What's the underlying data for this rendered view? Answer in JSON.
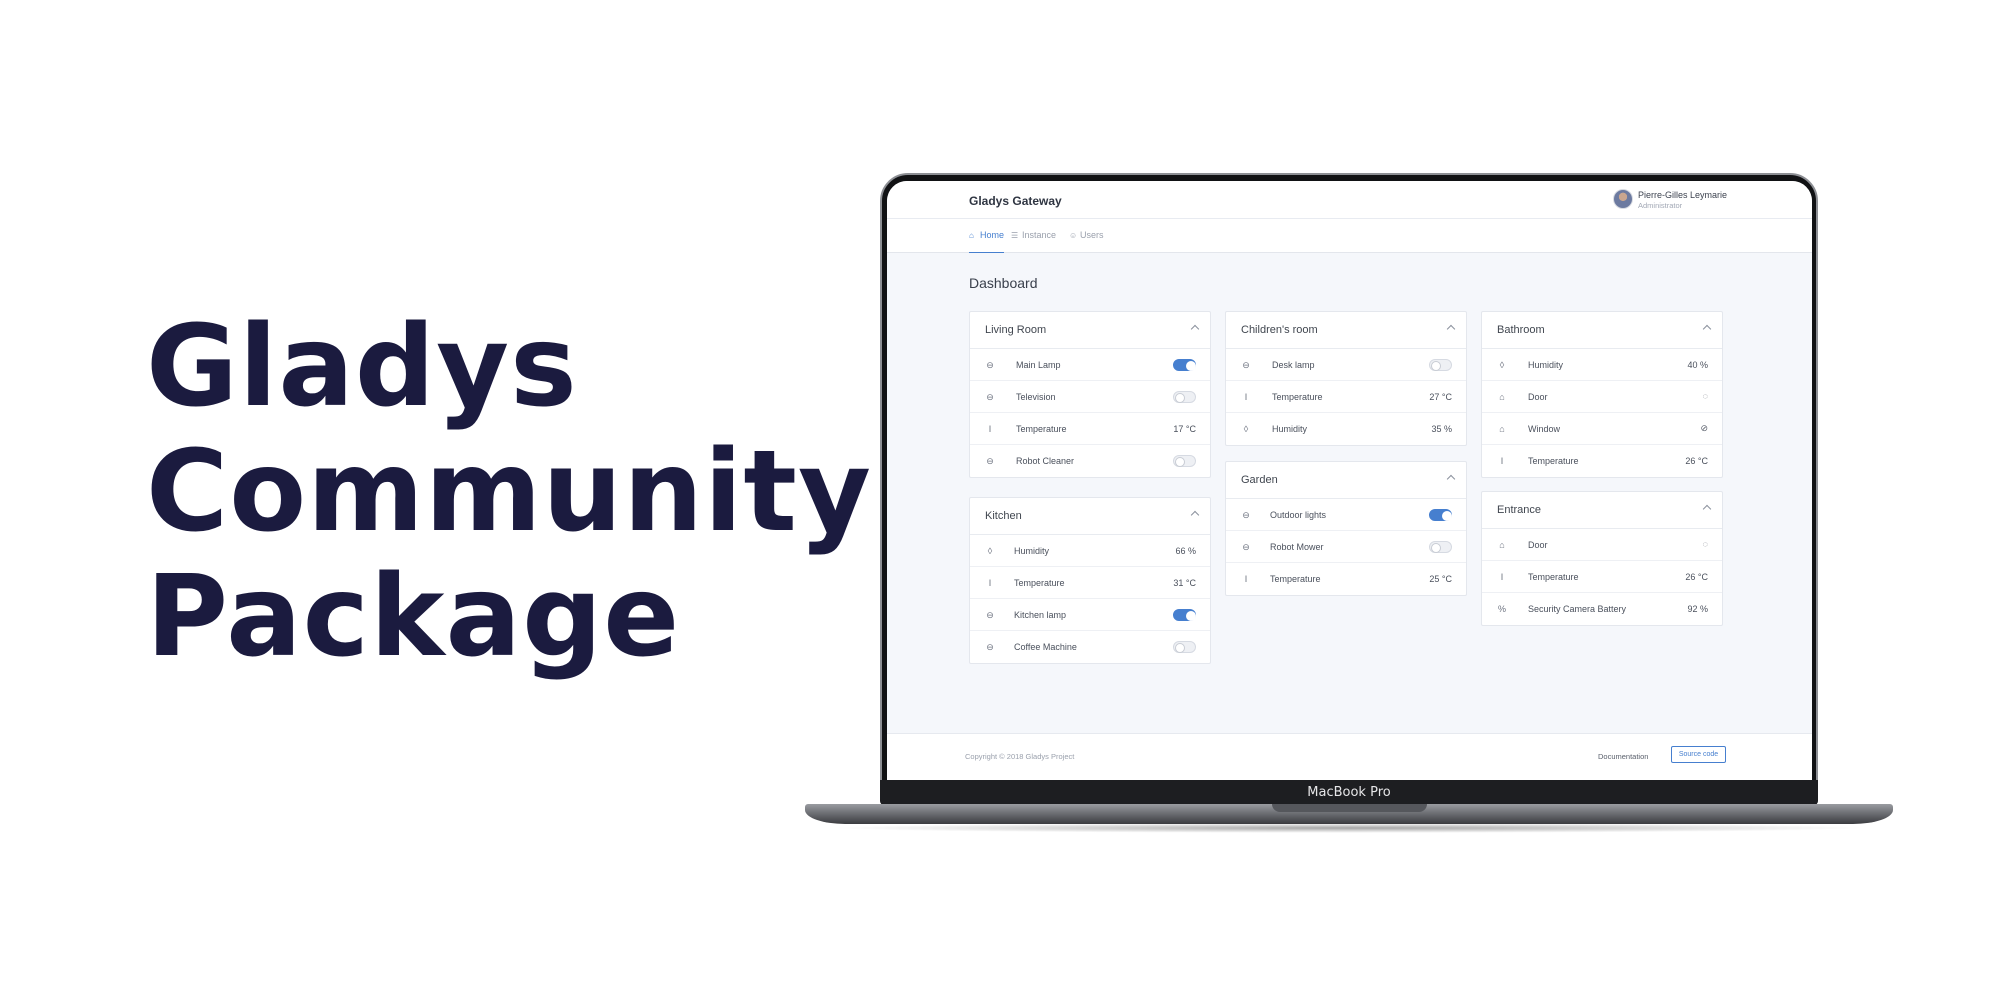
{
  "headline": {
    "line1": "Gladys",
    "line2": "Community",
    "line3": "Package"
  },
  "laptop": {
    "label": "MacBook Pro"
  },
  "app": {
    "brand": "Gladys Gateway",
    "user": {
      "name": "Pierre-Gilles Leymarie",
      "role": "Administrator"
    },
    "nav": [
      {
        "label": "Home",
        "icon": "home-icon",
        "active": true
      },
      {
        "label": "Instance",
        "icon": "server-icon",
        "active": false
      },
      {
        "label": "Users",
        "icon": "user-icon",
        "active": false
      }
    ],
    "page_title": "Dashboard",
    "accent_color": "#467fcf",
    "rooms": {
      "living_room": {
        "title": "Living Room",
        "rows": [
          {
            "icon": "toggle-icon",
            "label": "Main Lamp",
            "toggle": true
          },
          {
            "icon": "toggle-icon",
            "label": "Television",
            "toggle": false
          },
          {
            "icon": "thermometer-icon",
            "label": "Temperature",
            "value": "17 °C"
          },
          {
            "icon": "toggle-icon",
            "label": "Robot Cleaner",
            "toggle": false
          }
        ]
      },
      "kitchen": {
        "title": "Kitchen",
        "rows": [
          {
            "icon": "droplet-icon",
            "label": "Humidity",
            "value": "66 %"
          },
          {
            "icon": "thermometer-icon",
            "label": "Temperature",
            "value": "31 °C"
          },
          {
            "icon": "toggle-icon",
            "label": "Kitchen lamp",
            "toggle": true
          },
          {
            "icon": "toggle-icon",
            "label": "Coffee Machine",
            "toggle": false
          }
        ]
      },
      "childrens_room": {
        "title": "Children's room",
        "rows": [
          {
            "icon": "toggle-icon",
            "label": "Desk lamp",
            "toggle": false
          },
          {
            "icon": "thermometer-icon",
            "label": "Temperature",
            "value": "27 °C"
          },
          {
            "icon": "droplet-icon",
            "label": "Humidity",
            "value": "35 %"
          }
        ]
      },
      "garden": {
        "title": "Garden",
        "rows": [
          {
            "icon": "toggle-icon",
            "label": "Outdoor lights",
            "toggle": true
          },
          {
            "icon": "toggle-icon",
            "label": "Robot Mower",
            "toggle": false
          },
          {
            "icon": "thermometer-icon",
            "label": "Temperature",
            "value": "25 °C"
          }
        ]
      },
      "bathroom": {
        "title": "Bathroom",
        "rows": [
          {
            "icon": "droplet-icon",
            "label": "Humidity",
            "value": "40 %"
          },
          {
            "icon": "home-icon",
            "label": "Door",
            "status_icon": "shield-icon"
          },
          {
            "icon": "home-icon",
            "label": "Window",
            "status_icon": "shield-off-icon"
          },
          {
            "icon": "thermometer-icon",
            "label": "Temperature",
            "value": "26 °C"
          }
        ]
      },
      "entrance": {
        "title": "Entrance",
        "rows": [
          {
            "icon": "home-icon",
            "label": "Door",
            "status_icon": "shield-icon"
          },
          {
            "icon": "thermometer-icon",
            "label": "Temperature",
            "value": "26 °C"
          },
          {
            "icon": "percent-icon",
            "label": "Security Camera Battery",
            "value": "92 %"
          }
        ]
      }
    },
    "footer": {
      "copyright": "Copyright © 2018 Gladys Project",
      "documentation": "Documentation",
      "source_code": "Source code"
    }
  }
}
